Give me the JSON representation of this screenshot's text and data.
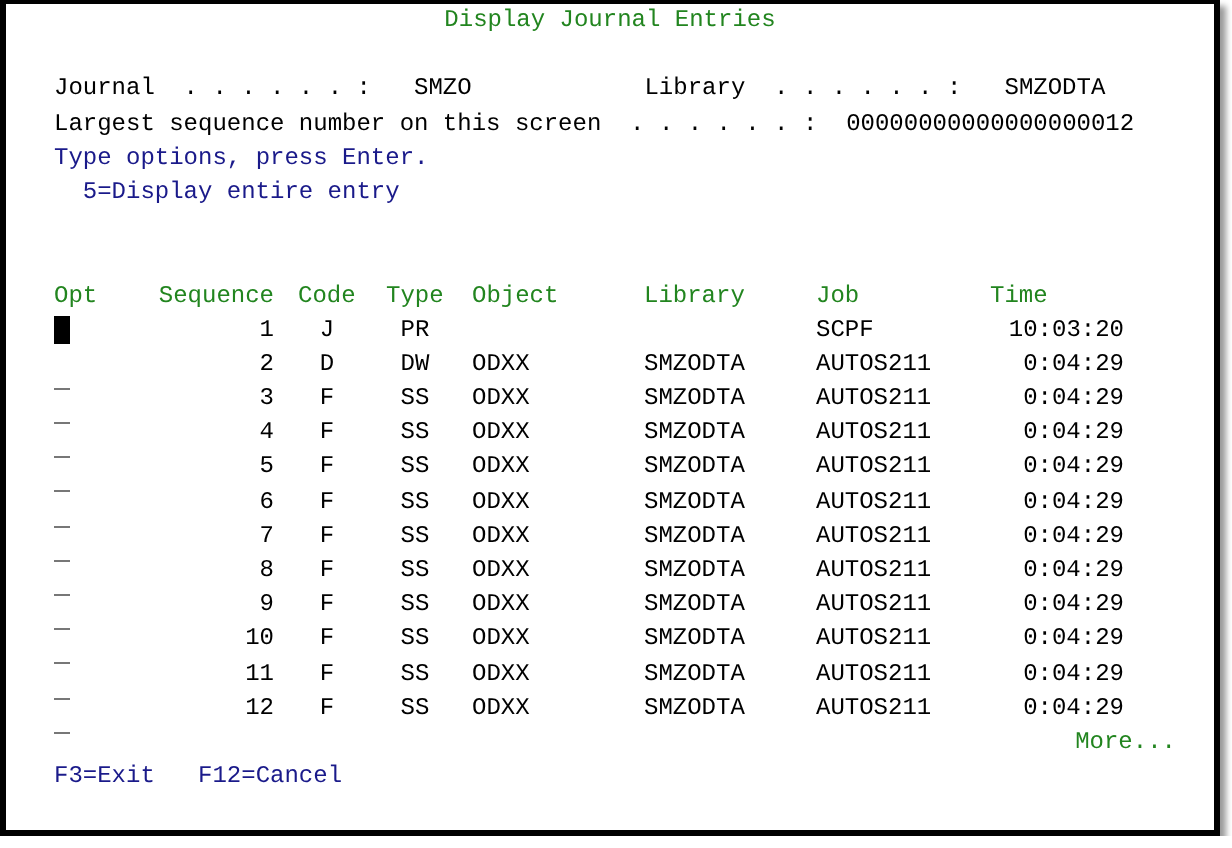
{
  "screen": {
    "title": "Display Journal Entries"
  },
  "header_fields": [
    {
      "label": "Journal  . . . . . . :",
      "value": "SMZO"
    },
    {
      "label": "Library  . . . . . . :",
      "value": "SMZODTA"
    }
  ],
  "largest_sequence": {
    "label": "Largest sequence number on this screen  . . . . . . :",
    "value": "00000000000000000012"
  },
  "instructions": "Type options, press Enter.",
  "options": [
    "5=Display entire entry"
  ],
  "columns": [
    "Opt",
    "Sequence",
    "Code",
    "Type",
    "Object",
    "Library",
    "Job",
    "Time"
  ],
  "rows": [
    {
      "focused": true,
      "sequence": "1",
      "code": "J",
      "type": "PR",
      "object": "",
      "library": "",
      "job": "SCPF",
      "time": "10:03:20"
    },
    {
      "focused": false,
      "sequence": "2",
      "code": "D",
      "type": "DW",
      "object": "ODXX",
      "library": "SMZODTA",
      "job": "AUTOS211",
      "time": "0:04:29"
    },
    {
      "focused": false,
      "sequence": "3",
      "code": "F",
      "type": "SS",
      "object": "ODXX",
      "library": "SMZODTA",
      "job": "AUTOS211",
      "time": "0:04:29"
    },
    {
      "focused": false,
      "sequence": "4",
      "code": "F",
      "type": "SS",
      "object": "ODXX",
      "library": "SMZODTA",
      "job": "AUTOS211",
      "time": "0:04:29"
    },
    {
      "focused": false,
      "sequence": "5",
      "code": "F",
      "type": "SS",
      "object": "ODXX",
      "library": "SMZODTA",
      "job": "AUTOS211",
      "time": "0:04:29"
    },
    {
      "focused": false,
      "sequence": "6",
      "code": "F",
      "type": "SS",
      "object": "ODXX",
      "library": "SMZODTA",
      "job": "AUTOS211",
      "time": "0:04:29"
    },
    {
      "focused": false,
      "sequence": "7",
      "code": "F",
      "type": "SS",
      "object": "ODXX",
      "library": "SMZODTA",
      "job": "AUTOS211",
      "time": "0:04:29"
    },
    {
      "focused": false,
      "sequence": "8",
      "code": "F",
      "type": "SS",
      "object": "ODXX",
      "library": "SMZODTA",
      "job": "AUTOS211",
      "time": "0:04:29"
    },
    {
      "focused": false,
      "sequence": "9",
      "code": "F",
      "type": "SS",
      "object": "ODXX",
      "library": "SMZODTA",
      "job": "AUTOS211",
      "time": "0:04:29"
    },
    {
      "focused": false,
      "sequence": "10",
      "code": "F",
      "type": "SS",
      "object": "ODXX",
      "library": "SMZODTA",
      "job": "AUTOS211",
      "time": "0:04:29"
    },
    {
      "focused": false,
      "sequence": "11",
      "code": "F",
      "type": "SS",
      "object": "ODXX",
      "library": "SMZODTA",
      "job": "AUTOS211",
      "time": "0:04:29"
    },
    {
      "focused": false,
      "sequence": "12",
      "code": "F",
      "type": "SS",
      "object": "ODXX",
      "library": "SMZODTA",
      "job": "AUTOS211",
      "time": "0:04:29"
    }
  ],
  "more": "More...",
  "function_keys": [
    "F3=Exit",
    "F12=Cancel"
  ]
}
